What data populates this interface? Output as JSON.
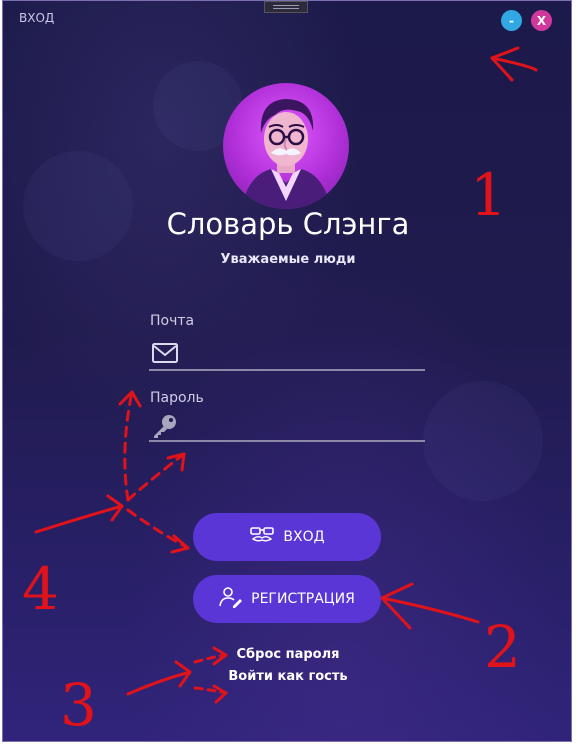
{
  "window": {
    "title": "ВХОД",
    "minimize_label": "-",
    "close_label": "X"
  },
  "header": {
    "app_title": "Словарь Слэнга",
    "subtitle": "Уважаемые люди"
  },
  "form": {
    "email": {
      "label": "Почта",
      "value": "",
      "icon": "envelope-icon"
    },
    "password": {
      "label": "Пароль",
      "value": "",
      "icon": "key-icon"
    }
  },
  "buttons": {
    "login_label": "ВХОД",
    "login_icon": "glasses-mustache-icon",
    "register_label": "РЕГИСТРАЦИЯ",
    "register_icon": "user-edit-icon"
  },
  "links": {
    "reset_password": "Сброс пароля",
    "guest_login": "Войти как гость"
  },
  "annotations": {
    "labels": [
      "1",
      "2",
      "3",
      "4"
    ]
  },
  "colors": {
    "button_bg": "#5a36d6",
    "minimize_btn": "#31a8e4",
    "close_btn": "#d0389b",
    "annotation": "#e0121a"
  }
}
